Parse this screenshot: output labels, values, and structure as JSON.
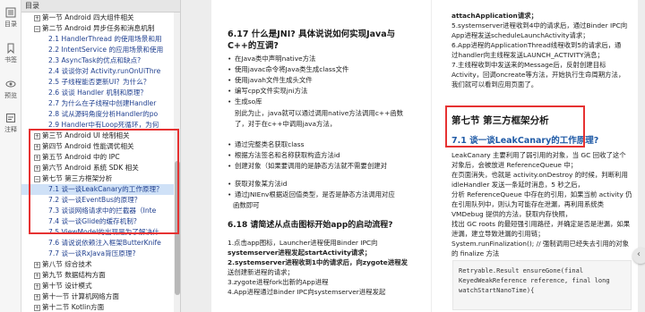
{
  "rail": {
    "items": [
      {
        "label": "目录",
        "icon": "toc-icon"
      },
      {
        "label": "书签",
        "icon": "bookmark-icon"
      },
      {
        "label": "预览",
        "icon": "preview-icon"
      },
      {
        "label": "注释",
        "icon": "annotation-icon"
      }
    ]
  },
  "toc": {
    "title": "目录",
    "rows": [
      {
        "text": "第一节 Android 四大组件相关",
        "box": "+",
        "child": false
      },
      {
        "text": "第二节 Android 异步任务和消息机制",
        "box": "−",
        "child": false
      },
      {
        "text": "2.1 HandlerThread 的使用场景和用",
        "box": "",
        "child": true
      },
      {
        "text": "2.2 IntentService 的应用场景和使用",
        "box": "",
        "child": true
      },
      {
        "text": "2.3 AsyncTask的优点和缺点?",
        "box": "",
        "child": true
      },
      {
        "text": "2.4 谈谈你对 Activity.runOnUiThre",
        "box": "",
        "child": true
      },
      {
        "text": "2.5 子线程能否更新UI？为什么？",
        "box": "",
        "child": true
      },
      {
        "text": "2.6 谈谈 Handler 机制和原理？",
        "box": "",
        "child": true
      },
      {
        "text": "2.7 为什么在子线程中创建Handler",
        "box": "",
        "child": true
      },
      {
        "text": "2.8 试从源码角度分析Handler的po",
        "box": "",
        "child": true
      },
      {
        "text": "2.9 Handler中有Loop死循环，为何",
        "box": "",
        "child": true
      },
      {
        "text": "第三节 Android UI 绘制相关",
        "box": "+",
        "child": false
      },
      {
        "text": "第四节 Android 性能调优相关",
        "box": "+",
        "child": false
      },
      {
        "text": "第五节 Android 中的 IPC",
        "box": "+",
        "child": false
      },
      {
        "text": "第六节 Android 系统 SDK 相关",
        "box": "+",
        "child": false
      },
      {
        "text": "第七节 第三方框架分析",
        "box": "−",
        "child": false
      },
      {
        "text": "7.1 谈一谈LeakCanary的工作原理？",
        "box": "",
        "child": true
      },
      {
        "text": "7.2 谈一谈EventBus的原理？",
        "box": "",
        "child": true
      },
      {
        "text": "7.3 谈谈网络请求中的拦截器（Inte",
        "box": "",
        "child": true
      },
      {
        "text": "7.4 谈一谈Glide的缓存机制?",
        "box": "",
        "child": true
      },
      {
        "text": "7.5 ViewModel的出现是为了解决什",
        "box": "",
        "child": true
      },
      {
        "text": "7.6 请说说依赖注入框架ButterKnife",
        "box": "",
        "child": true
      },
      {
        "text": "7.7 谈一谈RxJava背压原理?",
        "box": "",
        "child": true
      },
      {
        "text": "第八节 综合技术",
        "box": "+",
        "child": false
      },
      {
        "text": "第九节 数据结构方面",
        "box": "+",
        "child": false
      },
      {
        "text": "第十节 设计模式",
        "box": "+",
        "child": false
      },
      {
        "text": "第十一节 计算机网络方面",
        "box": "+",
        "child": false
      },
      {
        "text": "第十二节 Kotlin方面",
        "box": "+",
        "child": false
      }
    ]
  },
  "page_left": {
    "h1": "6.17 什么是JNI? 具体说说如何实现Java与",
    "h1b": "C++的互调?",
    "bullets": [
      "在Java类中声明native方法",
      "使用javac命令将Java类生成class文件",
      "使用javah文件生成头文件",
      "编写cpp文件实现jni方法",
      "生成so库",
      "创建Native函数，保证Java与相对应",
      "通过完整类名获取class",
      "根据方法签名和名称获取构造方法id",
      "创建对象（如果要调用的是静态方法就不需要创建对",
      "获取对象某方法id",
      "通过JNIEnv根据返回值类型，是否是静态方法调用对应",
      "函数即可"
    ],
    "para1": "别此为止，java就可以通过调用native方法调用c++函数",
    "para2": "了，对于在c++中调用java方法，",
    "h2": "6.18 请简述从点击图标开始app的启动流程?",
    "steps": [
      "1.点击app图标，Launcher进程使用Binder IPC向",
      "systemserver进程发起startActivity请求；",
      "2.systemserver进程收到1中的请求后，向zygote进程发",
      "送创建新进程的请求；",
      "3.zygote进程fork出新的App进程",
      "4.App进程通过Binder IPC向systemserver进程发起"
    ]
  },
  "page_right": {
    "top_lines": [
      "attachApplication请求；",
      "5.systemserver进程收到4中的请求后，通过Binder IPC向",
      "App进程发送scheduleLaunchActivity请求；",
      "6.App进程的ApplicationThread线程收到5的请求后，通",
      "过handler向主线程发送LAUNCH_ACTIVITY消息；",
      "7.主线程收到中发送来的Message后，反射创建目标",
      "Activity，回调oncreate等方法，开始执行生命周期方法，",
      "我们就可以看到应用页面了。"
    ],
    "chapter_title": "第七节 第三方框架分析",
    "section_title": "7.1 谈一谈LeakCanary的工作原理?",
    "body": [
      "LeakCanary 主要利用了弱引用的对象，当 GC 回收了这个",
      "对象后，会被放进 ReferenceQueue 中；",
      "在页面消失，也就是 activity.onDestroy 的时候，判断利用",
      "idleHandler 发送一条延时消息，5 秒之后，",
      "分析 ReferenceQueue 中存在的引用，如果当前 activity 仍",
      "在引用队列中，则认为可能存在泄漏，再利用系统类",
      "VMDebug 提供的方法，获取内存快照，",
      "找出 GC roots 的最短强引用路径，并确定是否是泄漏，如果",
      "泄漏，建立导致泄漏的引用链；",
      "System.runFinalization(); // 强制调用已经失去引用的对象",
      "的 finalize 方法"
    ],
    "code": [
      "Retryable.Result ensureGone(final",
      "KeyedWeakReference reference, final long",
      "watchStartNanoTime){"
    ]
  },
  "colors": {
    "highlight_frame": "#e63232",
    "link_blue": "#1f3f8f",
    "selected_row": "#cfe1f7"
  }
}
